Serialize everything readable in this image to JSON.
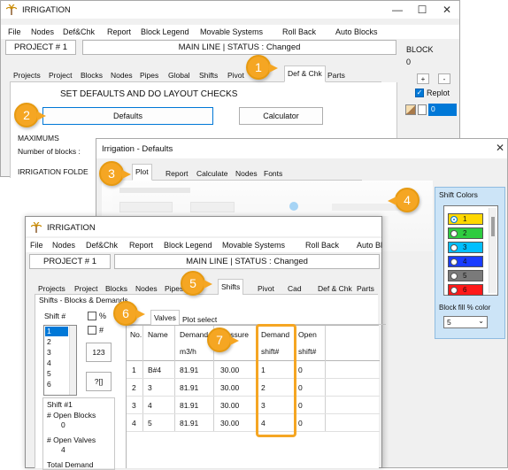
{
  "back_window": {
    "title": "IRRIGATION",
    "menu": [
      "File",
      "Nodes",
      "Def&Chk",
      "Report",
      "Block Legend",
      "Movable Systems",
      "Roll Back",
      "Auto Blocks"
    ],
    "project": "PROJECT # 1",
    "status": "MAIN LINE   |  STATUS : Changed",
    "tabs": [
      "Projects",
      "Project",
      "Blocks",
      "Nodes",
      "Pipes",
      "Global",
      "Shifts",
      "Pivot",
      "Def & Chk",
      "Parts"
    ],
    "section_title": "SET DEFAULTS AND DO LAYOUT CHECKS",
    "defaults_button": "Defaults",
    "calculator_button": "Calculator",
    "maximums_label": "MAXIMUMS",
    "blocks_label": "Number of blocks :",
    "cut_label": "IRRIGATION FOLDE",
    "block_panel": {
      "title": "BLOCK",
      "value": "0",
      "add": "+",
      "remove": "-",
      "replot": "Replot",
      "replot_checked": true,
      "input_value": "0"
    }
  },
  "defaults_window": {
    "title": "Irrigation - Defaults",
    "close": "✕",
    "tabs": [
      "Plot",
      "Report",
      "Calculate",
      "Nodes",
      "Fonts"
    ],
    "shift_colors": {
      "title": "Shift Colors",
      "items": [
        {
          "num": "1",
          "color": "#ffd700",
          "selected": true
        },
        {
          "num": "2",
          "color": "#2ecc40",
          "selected": false
        },
        {
          "num": "3",
          "color": "#00bfff",
          "selected": false
        },
        {
          "num": "4",
          "color": "#1a3cff",
          "selected": false
        },
        {
          "num": "5",
          "color": "#7a7a7a",
          "selected": false
        },
        {
          "num": "6",
          "color": "#ff1a1a",
          "selected": false
        }
      ],
      "fill_label": "Block fill % color",
      "fill_value": "5"
    }
  },
  "front_window": {
    "title": "IRRIGATION",
    "menu": [
      "File",
      "Nodes",
      "Def&Chk",
      "Report",
      "Block Legend",
      "Movable Systems",
      "Roll Back",
      "Auto Bl"
    ],
    "project": "PROJECT # 1",
    "status": "MAIN LINE   |  STATUS : Changed",
    "tabs": [
      "Projects",
      "Project",
      "Blocks",
      "Nodes",
      "Pipes",
      "Shifts",
      "Pivot",
      "Cad",
      "Def & Chk",
      "Parts"
    ],
    "group_title": "Shifts - Blocks & Demands",
    "shift_label": "Shift #",
    "shift_list": [
      "1",
      "2",
      "3",
      "4",
      "5",
      "6"
    ],
    "pct_label": "%",
    "hash_label": "#",
    "btn_123": "123",
    "btn_q": "?[]",
    "subtabs": [
      "Valves",
      "Plot select"
    ],
    "table": {
      "headers": [
        "No.",
        "Name",
        "Demand",
        "Pressure",
        "Demand",
        "Open"
      ],
      "units": [
        "",
        "",
        "m3/h",
        "",
        "shift#",
        "shift#"
      ],
      "rows": [
        [
          "1",
          "B#4",
          "81.91",
          "30.00",
          "1",
          "0"
        ],
        [
          "2",
          "3",
          "81.91",
          "30.00",
          "2",
          "0"
        ],
        [
          "3",
          "4",
          "81.91",
          "30.00",
          "3",
          "0"
        ],
        [
          "4",
          "5",
          "81.91",
          "30.00",
          "4",
          "0"
        ]
      ]
    },
    "summary": {
      "title": "Shift #1",
      "open_blocks_label": "# Open Blocks",
      "open_blocks": "0",
      "open_valves_label": "# Open Valves",
      "open_valves": "4",
      "total_label": "Total Demand"
    }
  },
  "callouts": [
    "1",
    "2",
    "3",
    "4",
    "5",
    "6",
    "7"
  ],
  "colors": {
    "callout": "#f5a623",
    "highlight": "#f5a623",
    "selection": "#0078d7",
    "shift_panel": "#cce4f7"
  }
}
